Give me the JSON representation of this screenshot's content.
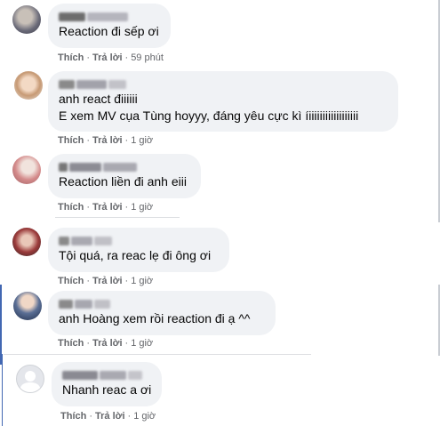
{
  "comments": [
    {
      "text_lines": [
        "Reaction đi sếp ơi"
      ],
      "like": "Thích",
      "reply": "Trả lời",
      "time": "59 phút"
    },
    {
      "text_lines": [
        "anh react điiiiii",
        "E xem MV cụa Tùng hoyyy, đáng yêu cực kì íiiiiiiiiiiiiiiiiii"
      ],
      "like": "Thích",
      "reply": "Trả lời",
      "time": "1 giờ"
    },
    {
      "text_lines": [
        "Reaction liền đi anh eiii"
      ],
      "like": "Thích",
      "reply": "Trả lời",
      "time": "1 giờ"
    },
    {
      "text_lines": [
        "Tội quá, ra reac lẹ đi ông ơi"
      ],
      "like": "Thích",
      "reply": "Trả lời",
      "time": "1 giờ"
    },
    {
      "text_lines": [
        "anh Hoàng xem rồi reaction đi ạ ^^"
      ],
      "like": "Thích",
      "reply": "Trả lời",
      "time": "1 giờ"
    },
    {
      "text_lines": [
        "Nhanh reac a ơi"
      ],
      "like": "Thích",
      "reply": "Trả lời",
      "time": "1 giờ"
    }
  ],
  "separator": "·",
  "colors": {
    "bubble_bg": "#f0f2f5",
    "text": "#050505",
    "meta": "#65676b",
    "thread_line": "#4267b2"
  },
  "icons": [
    "avatar",
    "default-avatar-icon"
  ]
}
